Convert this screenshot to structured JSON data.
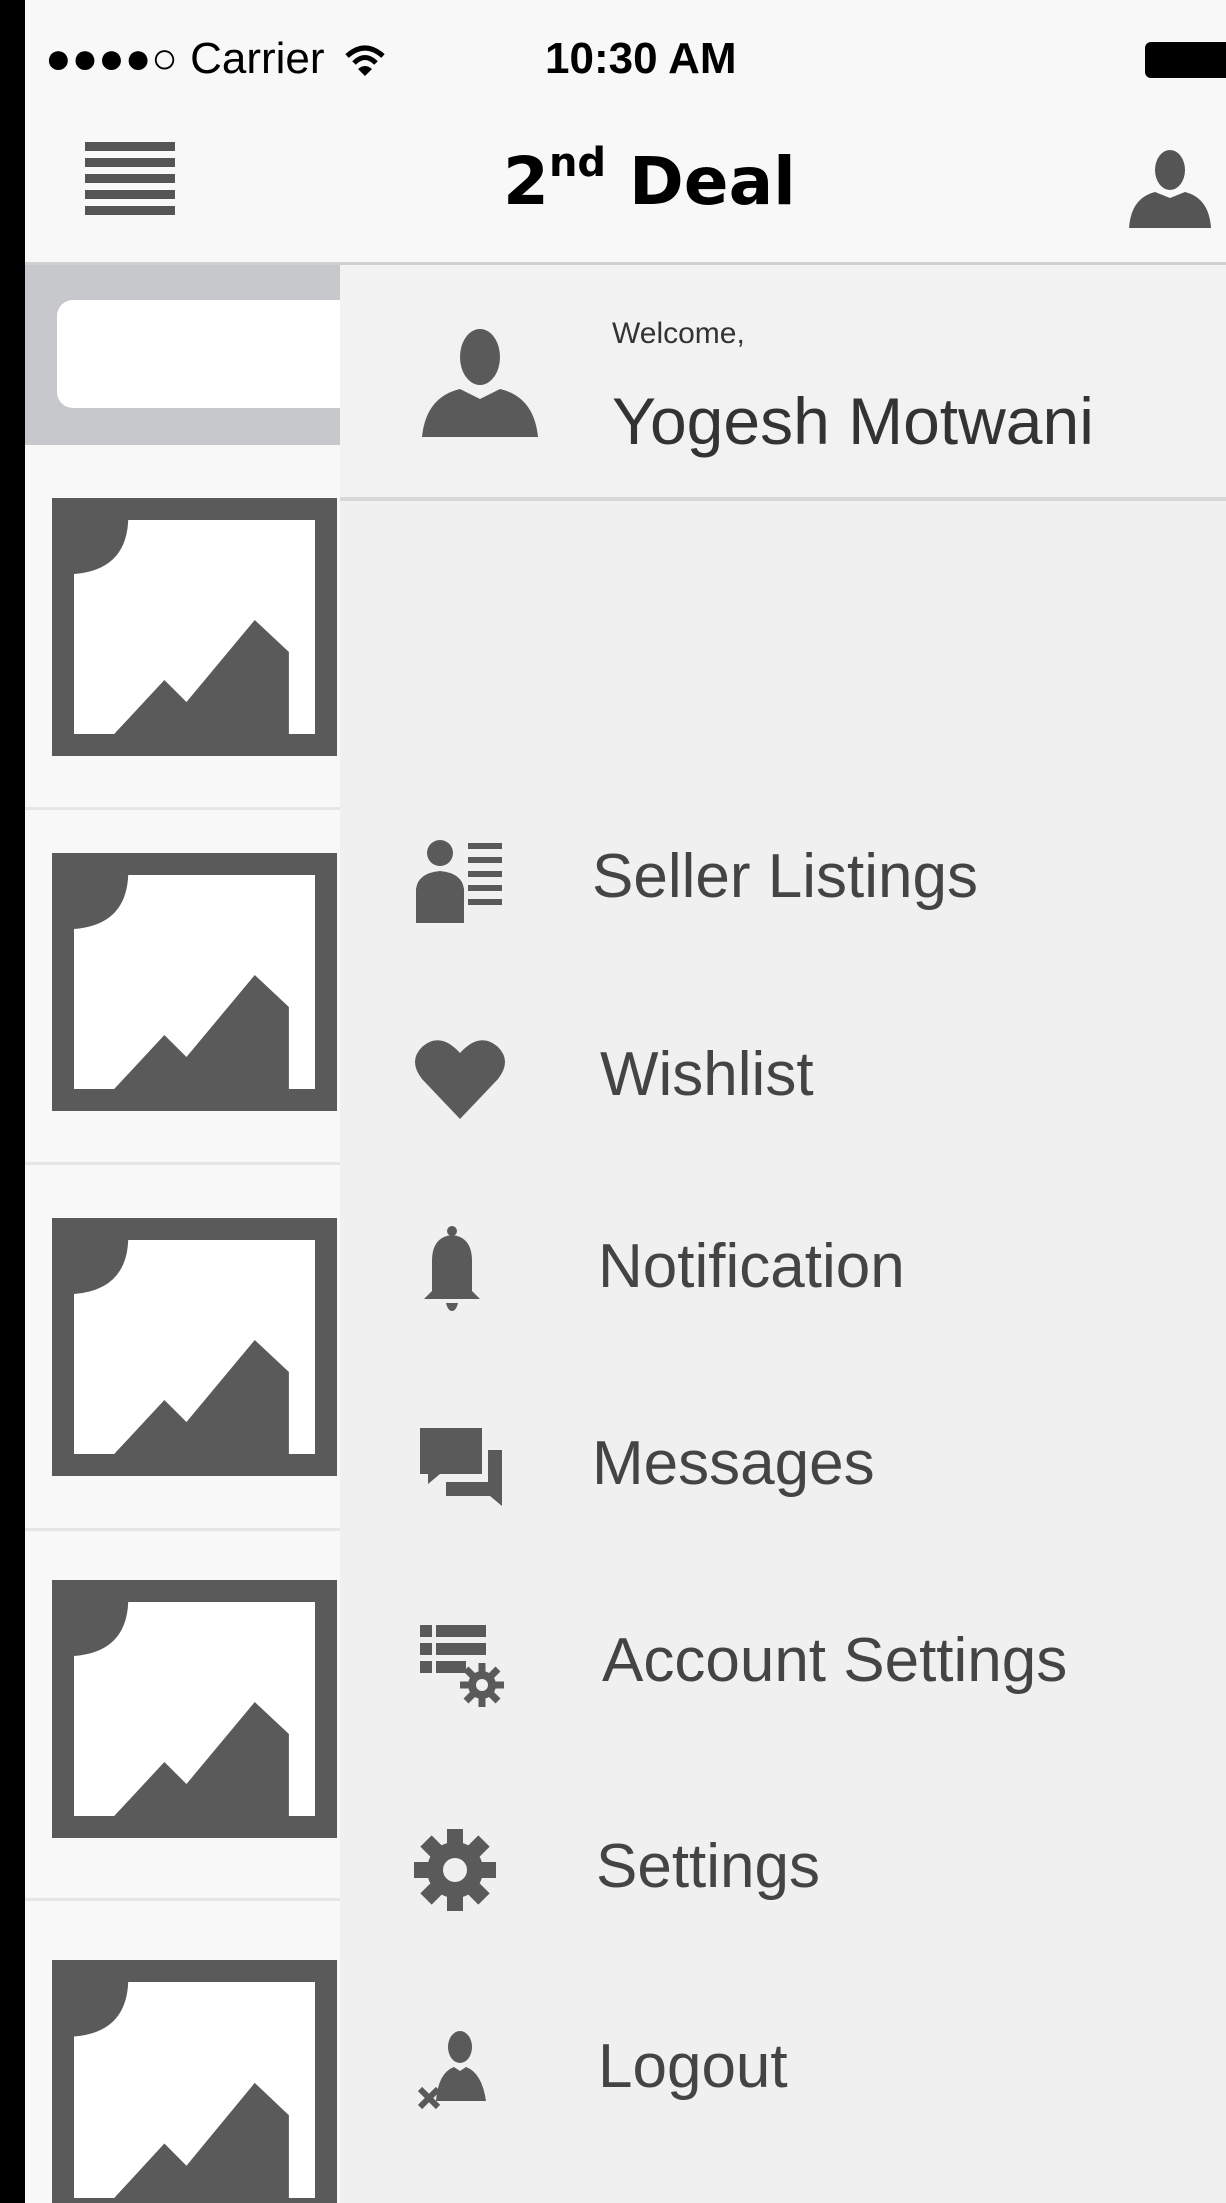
{
  "status_bar": {
    "carrier": "●●●●○ Carrier",
    "time": "10:30 AM"
  },
  "nav": {
    "title_main": "2",
    "title_sup": "nd",
    "title_rest": " Deal",
    "menu_icon": "hamburger-icon",
    "profile_icon": "user-icon"
  },
  "drawer": {
    "welcome": "Welcome,",
    "user_name": "Yogesh Motwani",
    "items": [
      {
        "label": "Seller Listings",
        "icon": "seller-listings-icon"
      },
      {
        "label": "Wishlist",
        "icon": "heart-icon"
      },
      {
        "label": "Notification",
        "icon": "bell-icon"
      },
      {
        "label": "Messages",
        "icon": "chat-icon"
      },
      {
        "label": "Account Settings",
        "icon": "account-settings-icon"
      },
      {
        "label": "Settings",
        "icon": "gear-icon"
      },
      {
        "label": "Logout",
        "icon": "logout-icon"
      }
    ]
  },
  "colors": {
    "icon_gray": "#5a5a5a",
    "drawer_bg": "#f0f0f0",
    "search_bg": "#c7c8cc"
  }
}
